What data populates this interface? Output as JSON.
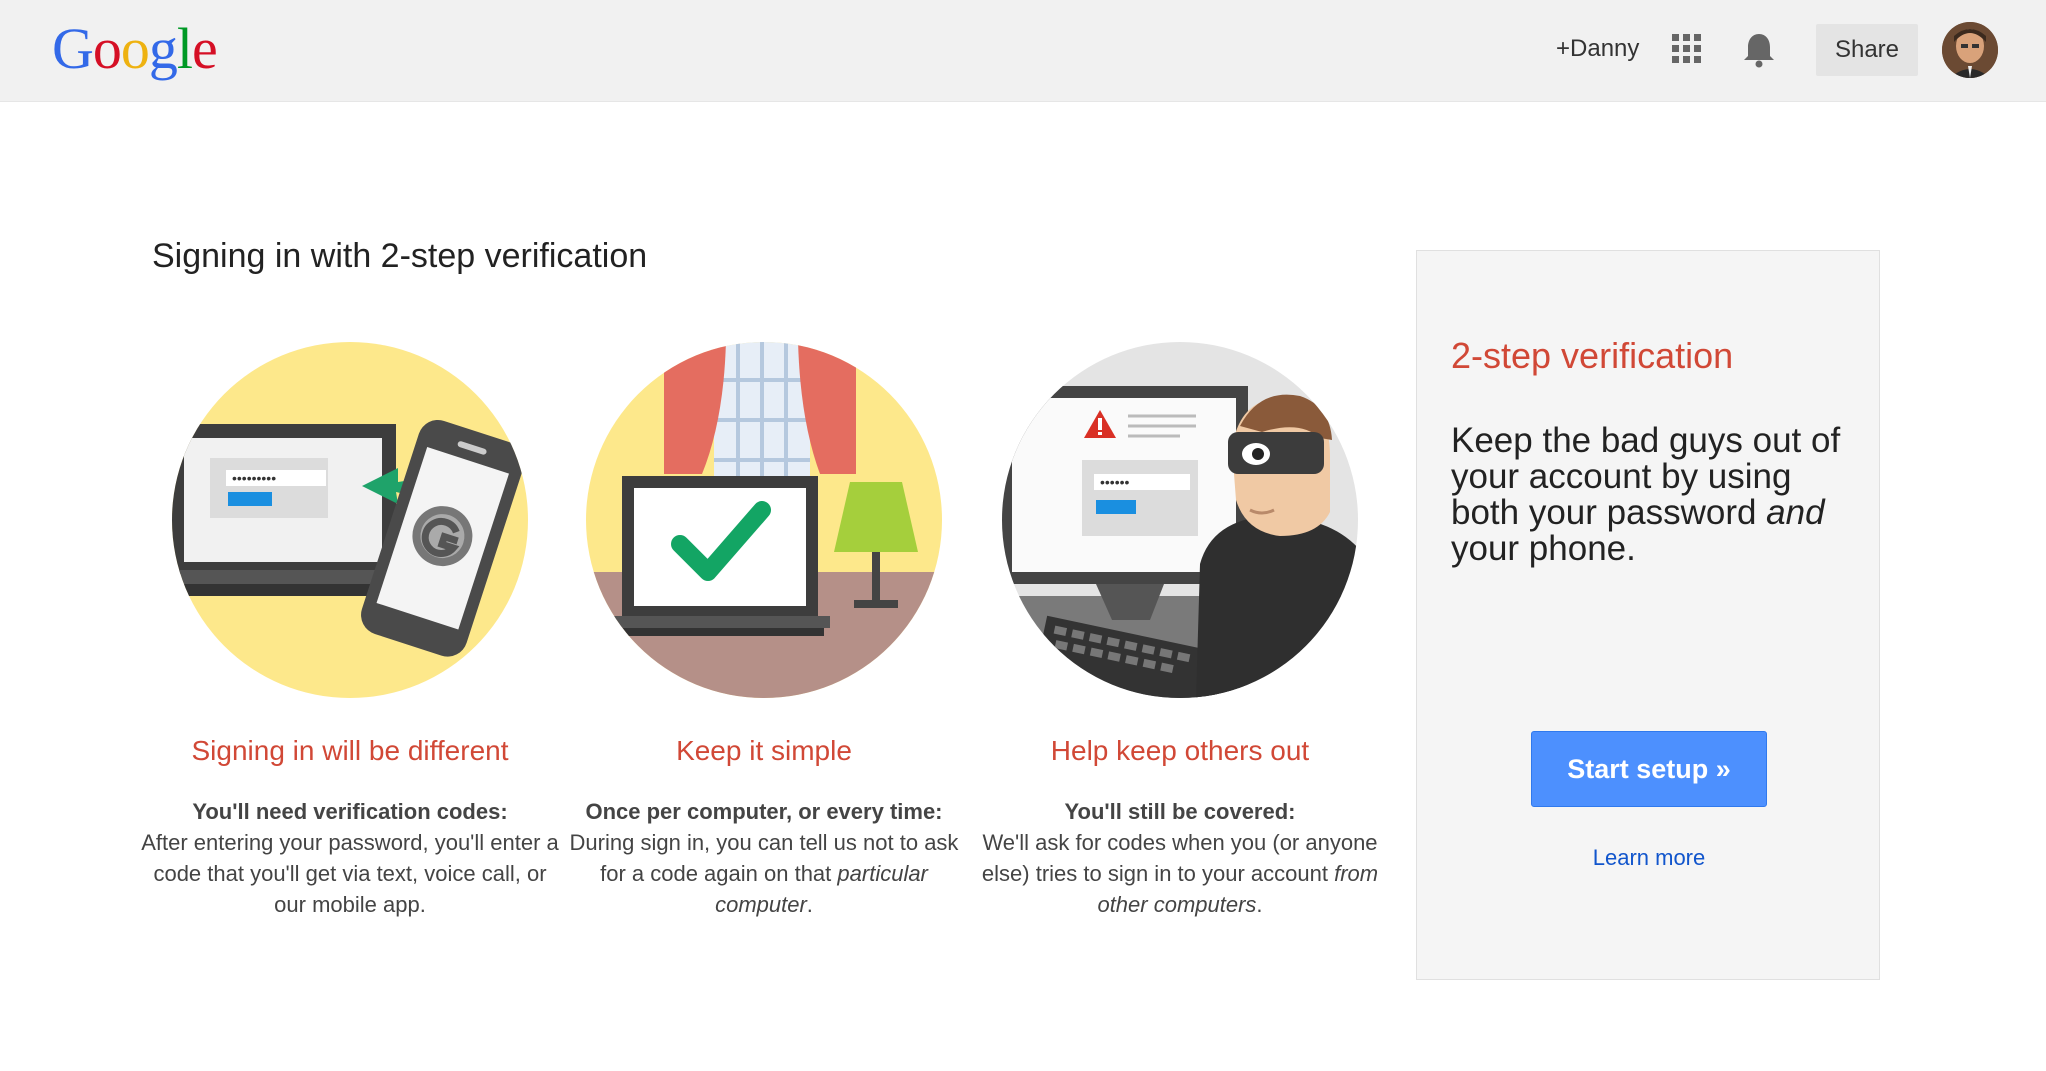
{
  "header": {
    "logo_letters": [
      "G",
      "o",
      "o",
      "g",
      "l",
      "e"
    ],
    "logo_colors": [
      "#3369e8",
      "#d50f25",
      "#eeb211",
      "#3369e8",
      "#009925",
      "#d50f25"
    ],
    "plus_user": "+Danny",
    "share_label": "Share",
    "apps_icon": "apps-grid-icon",
    "bell_icon": "notifications-bell-icon"
  },
  "main": {
    "title": "Signing in with 2-step verification",
    "features": [
      {
        "title": "Signing in will be different",
        "lead": "You'll need verification codes:",
        "text": "After entering your password, you'll enter a code that you'll get via text, voice call, or our mobile app."
      },
      {
        "title": "Keep it simple",
        "lead": "Once per computer, or every time:",
        "text_before": "During sign in, you can tell us not to ask for a code again on that ",
        "text_italic": "particular computer",
        "text_after": "."
      },
      {
        "title": "Help keep others out",
        "lead": "You'll still be covered:",
        "text_before": "We'll ask for codes when you (or anyone else) tries to sign in to your account ",
        "text_italic": "from other computers",
        "text_after": "."
      }
    ]
  },
  "card": {
    "title": "2-step verification",
    "body_before": "Keep the bad guys out of your account by using both your password ",
    "body_italic": "and",
    "body_after": " your phone.",
    "start_label": "Start setup »",
    "learn_label": "Learn more"
  },
  "colors": {
    "accent_red": "#d14836",
    "button_blue": "#4d90fe",
    "link_blue": "#1155cc",
    "check_green": "#0f9d58"
  }
}
